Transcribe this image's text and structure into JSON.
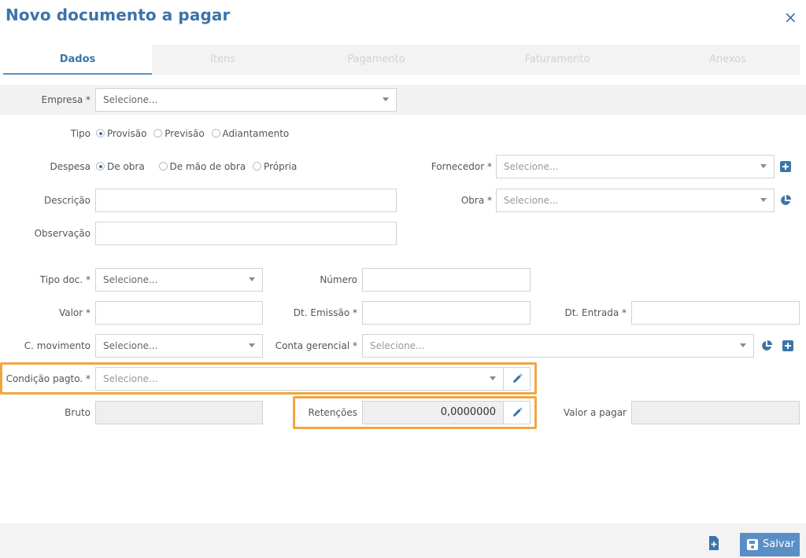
{
  "dialog": {
    "title": "Novo documento a pagar",
    "close_label": "×"
  },
  "tabs": [
    {
      "label": "Dados",
      "active": true
    },
    {
      "label": "Itens",
      "active": false
    },
    {
      "label": "Pagamento",
      "active": false
    },
    {
      "label": "Faturamento",
      "active": false
    },
    {
      "label": "Anexos",
      "active": false
    }
  ],
  "form": {
    "empresa": {
      "label": "Empresa *",
      "placeholder": "Selecione..."
    },
    "tipo": {
      "label": "Tipo",
      "options": [
        "Provisão",
        "Previsão",
        "Adiantamento"
      ],
      "selected": "Provisão"
    },
    "despesa": {
      "label": "Despesa",
      "options": [
        "De obra",
        "De mão de obra",
        "Própria"
      ],
      "selected": "De obra"
    },
    "fornecedor": {
      "label": "Fornecedor *",
      "placeholder": "Selecione..."
    },
    "descricao": {
      "label": "Descrição",
      "value": ""
    },
    "obra": {
      "label": "Obra *",
      "placeholder": "Selecione..."
    },
    "observacao": {
      "label": "Observação",
      "value": ""
    },
    "tipo_doc": {
      "label": "Tipo doc. *",
      "placeholder": "Selecione..."
    },
    "numero": {
      "label": "Número",
      "value": ""
    },
    "valor": {
      "label": "Valor *",
      "value": ""
    },
    "dt_emissao": {
      "label": "Dt. Emissão *",
      "value": ""
    },
    "dt_entrada": {
      "label": "Dt. Entrada *",
      "value": ""
    },
    "c_movimento": {
      "label": "C. movimento",
      "placeholder": "Selecione..."
    },
    "conta_gerencial": {
      "label": "Conta gerencial *",
      "placeholder": "Selecione..."
    },
    "condicao_pagto": {
      "label": "Condição pagto. *",
      "placeholder": "Selecione..."
    },
    "bruto": {
      "label": "Bruto",
      "value": ""
    },
    "retencoes": {
      "label": "Retenções",
      "value": "0,0000000"
    },
    "valor_a_pagar": {
      "label": "Valor a pagar",
      "value": ""
    }
  },
  "footer": {
    "save_label": "Salvar"
  },
  "colors": {
    "accent": "#3c74a9",
    "button": "#5a8fc5",
    "highlight": "#f0a640"
  }
}
